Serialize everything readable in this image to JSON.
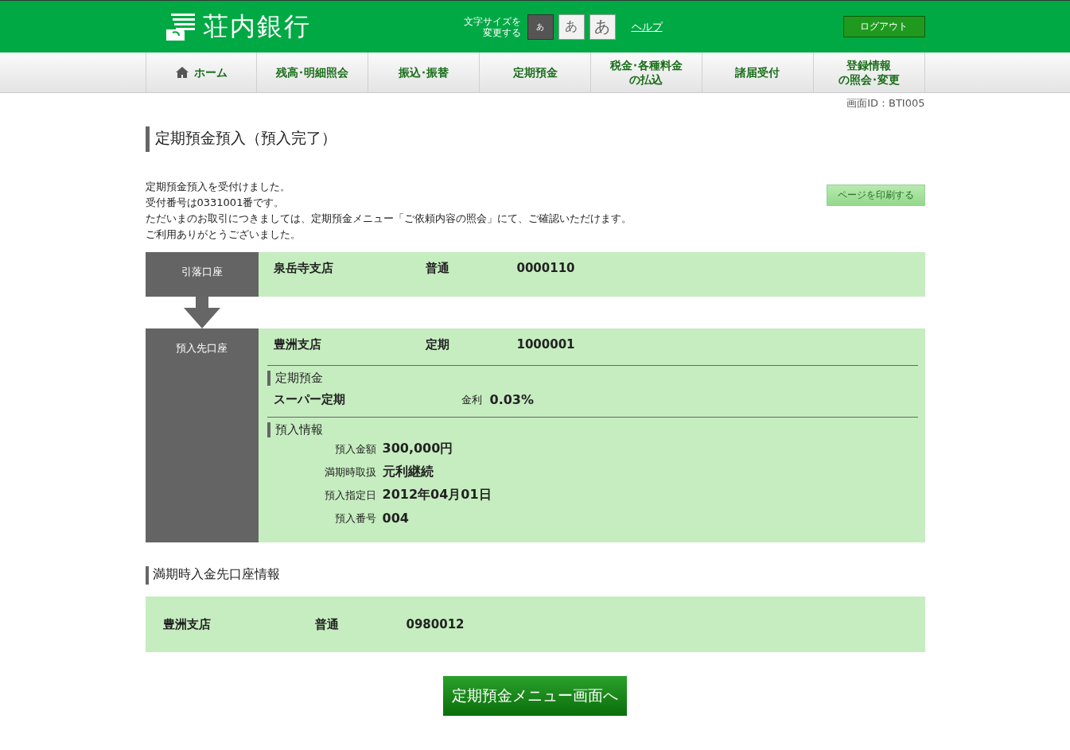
{
  "header": {
    "logo": "荘内銀行",
    "font_size_label": [
      "文字サイズを",
      "変更する"
    ],
    "font_sizes": [
      {
        "label": "あ",
        "selected": true
      },
      {
        "label": "あ",
        "selected": false
      },
      {
        "label": "あ",
        "selected": false
      }
    ],
    "help": "ヘルプ",
    "logout": "ログアウト"
  },
  "nav": [
    {
      "label": [
        "ホーム"
      ],
      "kind": "home"
    },
    {
      "label": [
        "残高･明細照会"
      ],
      "kind": "text"
    },
    {
      "label": [
        "振込･振替"
      ],
      "kind": "text"
    },
    {
      "label": [
        "定期預金"
      ],
      "kind": "text"
    },
    {
      "label": [
        "税金･各種料金",
        "の払込"
      ],
      "kind": "text"
    },
    {
      "label": [
        "諸届受付"
      ],
      "kind": "text"
    },
    {
      "label": [
        "登録情報",
        "の照会･変更"
      ],
      "kind": "text"
    }
  ],
  "screen_id": "画面ID：BTI005",
  "title": "定期預金預入（預入完了）",
  "messages": [
    "定期預金預入を受付けました。",
    "受付番号は0331001番です。",
    "ただいまのお取引につきましては、定期預金メニュー「ご依頼内容の照会」にて、ご確認いただけます。",
    "ご利用ありがとうございました。"
  ],
  "print_button": "ページを印刷する",
  "debit_account": {
    "label": "引落口座",
    "branch": "泉岳寺支店",
    "type": "普通",
    "number": "0000110"
  },
  "deposit_account": {
    "label": "預入先口座",
    "branch": "豊洲支店",
    "type": "定期",
    "number": "1000001",
    "product_heading": "定期預金",
    "product": "スーパー定期",
    "rate_label": "金利",
    "rate": "0.03%",
    "info_heading": "預入情報",
    "info": [
      {
        "label": "預入金額",
        "value": "300,000円"
      },
      {
        "label": "満期時取扱",
        "value": "元利継続"
      },
      {
        "label": "預入指定日",
        "value": "2012年04月01日"
      },
      {
        "label": "預入番号",
        "value": "004"
      }
    ]
  },
  "maturity": {
    "heading": "満期時入金先口座情報",
    "branch": "豊洲支店",
    "type": "普通",
    "number": "0980012"
  },
  "menu_button": "定期預金メニュー画面へ"
}
